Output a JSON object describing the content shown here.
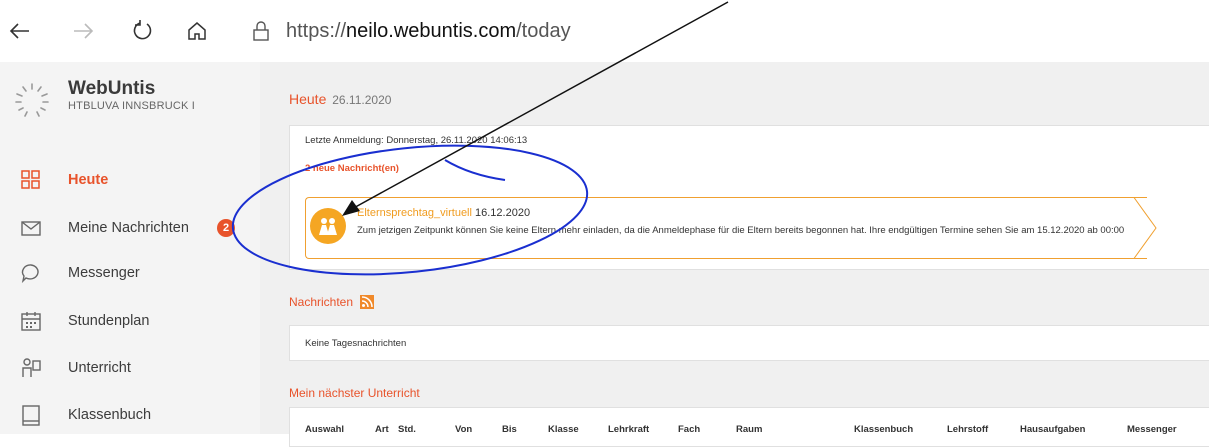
{
  "browser": {
    "url_prefix": "https://",
    "url_host": "neilo.webuntis.com",
    "url_path": "/today"
  },
  "brand": {
    "name": "WebUntis",
    "school": "HTBLUVA INNSBRUCK I"
  },
  "sidebar": {
    "items": [
      {
        "label": "Heute",
        "icon": "dashboard-icon"
      },
      {
        "label": "Meine Nachrichten",
        "icon": "mail-icon",
        "badge": "2"
      },
      {
        "label": "Messenger",
        "icon": "chat-bubble-icon"
      },
      {
        "label": "Stundenplan",
        "icon": "calendar-icon"
      },
      {
        "label": "Unterricht",
        "icon": "teacher-icon"
      },
      {
        "label": "Klassenbuch",
        "icon": "book-icon"
      }
    ]
  },
  "main": {
    "title": "Heute",
    "date": "26.11.2020",
    "last_login": "Letzte Anmeldung: Donnerstag, 26.11.2020 14:06:13",
    "new_messages": "2 neue Nachricht(en)",
    "notice": {
      "title": "Elternsprechtag_virtuell",
      "date": "16.12.2020",
      "body": "Zum jetzigen Zeitpunkt können Sie keine Eltern mehr einladen, da die Anmeldephase für die Eltern bereits begonnen hat. Ihre endgültigen Termine sehen Sie am 15.12.2020 ab 00:00"
    },
    "news_title": "Nachrichten",
    "news_empty": "Keine Tagesnachrichten",
    "next_lesson_title": "Mein nächster Unterricht",
    "table_headers": [
      "Auswahl",
      "Art",
      "Std.",
      "Von",
      "Bis",
      "Klasse",
      "Lehrkraft",
      "Fach",
      "Raum",
      "Klassenbuch",
      "Lehrstoff",
      "Hausaufgaben",
      "Messenger"
    ]
  },
  "colors": {
    "accent": "#e8532b",
    "notice": "#f5a623",
    "annotation": "#1a2fd0"
  }
}
